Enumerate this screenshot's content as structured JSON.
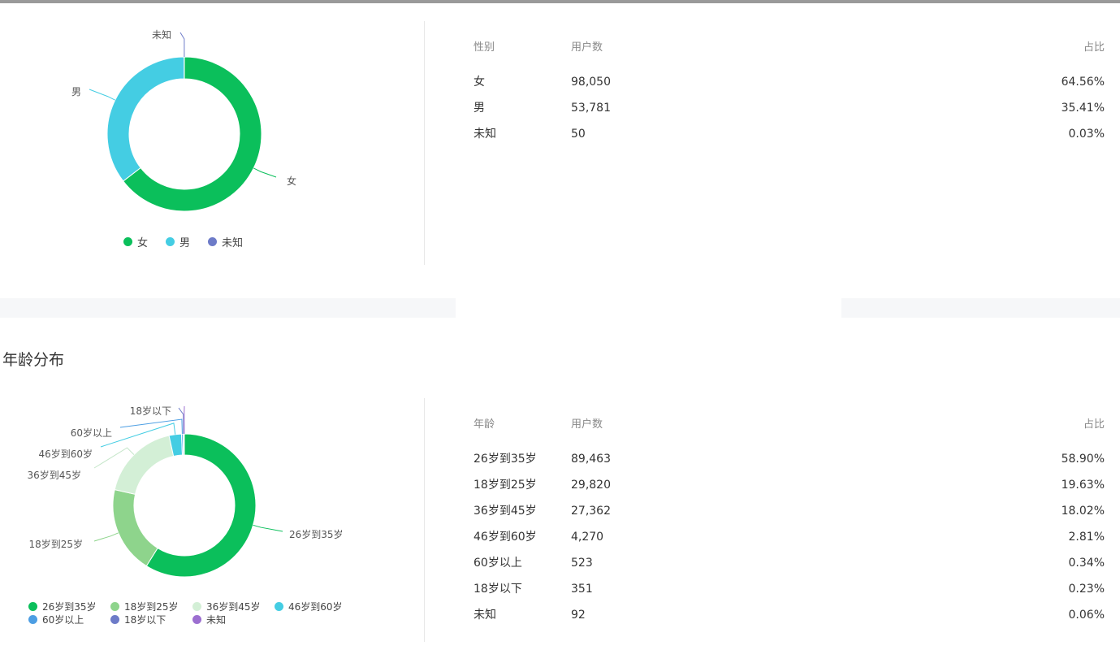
{
  "age_section_title": "年龄分布",
  "gender_table": {
    "headers": [
      "性别",
      "用户数",
      "占比"
    ],
    "rows": [
      [
        "女",
        "98,050",
        "64.56%"
      ],
      [
        "男",
        "53,781",
        "35.41%"
      ],
      [
        "未知",
        "50",
        "0.03%"
      ]
    ]
  },
  "age_table": {
    "headers": [
      "年龄",
      "用户数",
      "占比"
    ],
    "rows": [
      [
        "26岁到35岁",
        "89,463",
        "58.90%"
      ],
      [
        "18岁到25岁",
        "29,820",
        "19.63%"
      ],
      [
        "36岁到45岁",
        "27,362",
        "18.02%"
      ],
      [
        "46岁到60岁",
        "4,270",
        "2.81%"
      ],
      [
        "60岁以上",
        "523",
        "0.34%"
      ],
      [
        "18岁以下",
        "351",
        "0.23%"
      ],
      [
        "未知",
        "92",
        "0.06%"
      ]
    ]
  },
  "chart_data": [
    {
      "type": "pie",
      "labels": [
        "女",
        "男",
        "未知"
      ],
      "values": [
        98050,
        53781,
        50
      ],
      "colors": [
        "#0bbf5b",
        "#44cde3",
        "#6d7bc8"
      ],
      "legend": "bottom"
    },
    {
      "type": "pie",
      "labels": [
        "26岁到35岁",
        "18岁到25岁",
        "36岁到45岁",
        "46岁到60岁",
        "60岁以上",
        "18岁以下",
        "未知"
      ],
      "values": [
        89463,
        29820,
        27362,
        4270,
        523,
        351,
        92
      ],
      "colors": [
        "#0bbf5b",
        "#8ed48c",
        "#d3efd6",
        "#44cde3",
        "#4c9ee3",
        "#6d7bc8",
        "#9c6fd0"
      ],
      "legend": "bottom"
    }
  ]
}
